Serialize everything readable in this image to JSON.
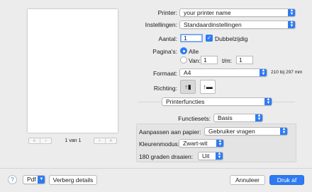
{
  "preview": {
    "page_label": "1 van 1"
  },
  "printer": {
    "label": "Printer:",
    "value": "your printer name"
  },
  "presets": {
    "label": "Instellingen:",
    "value": "Standaardinstellingen"
  },
  "copies": {
    "label": "Aantal:",
    "value": "1",
    "duplex_label": "Dubbelzijdig"
  },
  "pages": {
    "label": "Pagina's:",
    "all_label": "Alle",
    "from_label": "Van:",
    "from_value": "1",
    "to_label": "t/m:",
    "to_value": "1"
  },
  "paper": {
    "label": "Formaat:",
    "value": "A4",
    "size_text": "210 bij 297 mm"
  },
  "orientation": {
    "label": "Richting:"
  },
  "section": {
    "value": "Printerfuncties"
  },
  "feature_sets": {
    "label": "Functiesets:",
    "value": "Basis"
  },
  "options": {
    "fit_label": "Aanpassen aan papier:",
    "fit_value": "Gebruiker vragen",
    "color_label": "Kleurenmodus:",
    "color_value": "Zwart-wit",
    "rotate_label": "180 graden draaien:",
    "rotate_value": "Uit"
  },
  "footer": {
    "help": "?",
    "pdf_label": "Pdf",
    "details_label": "Verberg details",
    "cancel_label": "Annuleer",
    "print_label": "Druk af"
  },
  "colors": {
    "accent": "#2d7bf2",
    "window": "#ececec"
  }
}
